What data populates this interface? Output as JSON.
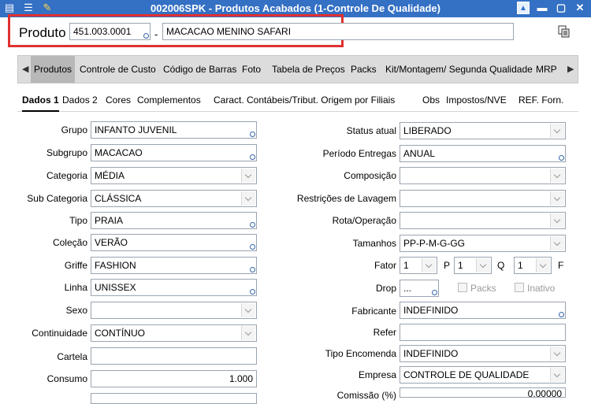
{
  "window": {
    "title": "002006SPK - Produtos Acabados (1-Controle De Qualidade)"
  },
  "header": {
    "produto_label": "Produto",
    "produto_code": "451.003.0001",
    "separator": "-",
    "produto_name": "MACACAO MENINO SAFARI"
  },
  "tabs": [
    {
      "label": "Produtos"
    },
    {
      "label": "Controle de Custo"
    },
    {
      "label": "Código de Barras"
    },
    {
      "label": "Foto"
    },
    {
      "label": "Tabela de Preços"
    },
    {
      "label": "Packs"
    },
    {
      "label": "Kit/Montagem/ Segunda Qualidade"
    },
    {
      "label": "MRP"
    }
  ],
  "subtabs": [
    {
      "label": "Dados 1"
    },
    {
      "label": "Dados 2"
    },
    {
      "label": "Cores"
    },
    {
      "label": "Complementos"
    },
    {
      "label": "Caract. Contábeis/Tribut. Origem por Filiais"
    },
    {
      "label": "Obs"
    },
    {
      "label": "Impostos/NVE"
    },
    {
      "label": "REF. Forn."
    }
  ],
  "left_fields": [
    {
      "label": "Grupo",
      "value": "INFANTO JUVENIL"
    },
    {
      "label": "Subgrupo",
      "value": "MACACAO"
    },
    {
      "label": "Categoria",
      "value": "MÉDIA"
    },
    {
      "label": "Sub Categoria",
      "value": "CLÁSSICA"
    },
    {
      "label": "Tipo",
      "value": "PRAIA"
    },
    {
      "label": "Coleção",
      "value": "VERÃO"
    },
    {
      "label": "Griffe",
      "value": "FASHION"
    },
    {
      "label": "Linha",
      "value": "UNISSEX"
    },
    {
      "label": "Sexo",
      "value": ""
    },
    {
      "label": "Continuidade",
      "value": "CONTÍNUO"
    },
    {
      "label": "Cartela",
      "value": ""
    },
    {
      "label": "Consumo",
      "value": "1.000"
    }
  ],
  "right_fields": [
    {
      "label": "Status atual",
      "value": "LIBERADO"
    },
    {
      "label": "Período Entregas",
      "value": "ANUAL"
    },
    {
      "label": "Composição",
      "value": ""
    },
    {
      "label": "Restrições de Lavagem",
      "value": ""
    },
    {
      "label": "Rota/Operação",
      "value": ""
    },
    {
      "label": "Tamanhos",
      "value": "PP-P-M-G-GG"
    },
    {
      "label": "Fator",
      "value": "1"
    },
    {
      "label": "Drop",
      "value": "..."
    },
    {
      "label": "Fabricante",
      "value": "INDEFINIDO"
    },
    {
      "label": "Refer",
      "value": ""
    },
    {
      "label": "Tipo Encomenda",
      "value": "INDEFINIDO"
    },
    {
      "label": "Empresa",
      "value": "CONTROLE DE QUALIDADE"
    },
    {
      "label": "Comissão (%)",
      "value": "0,00000"
    }
  ],
  "fator_extra": {
    "p_label": "P",
    "p_value": "1",
    "q_label": "Q",
    "q_value": "1",
    "f_label": "F"
  },
  "checkboxes": {
    "packs": "Packs",
    "inativo": "Inativo"
  }
}
